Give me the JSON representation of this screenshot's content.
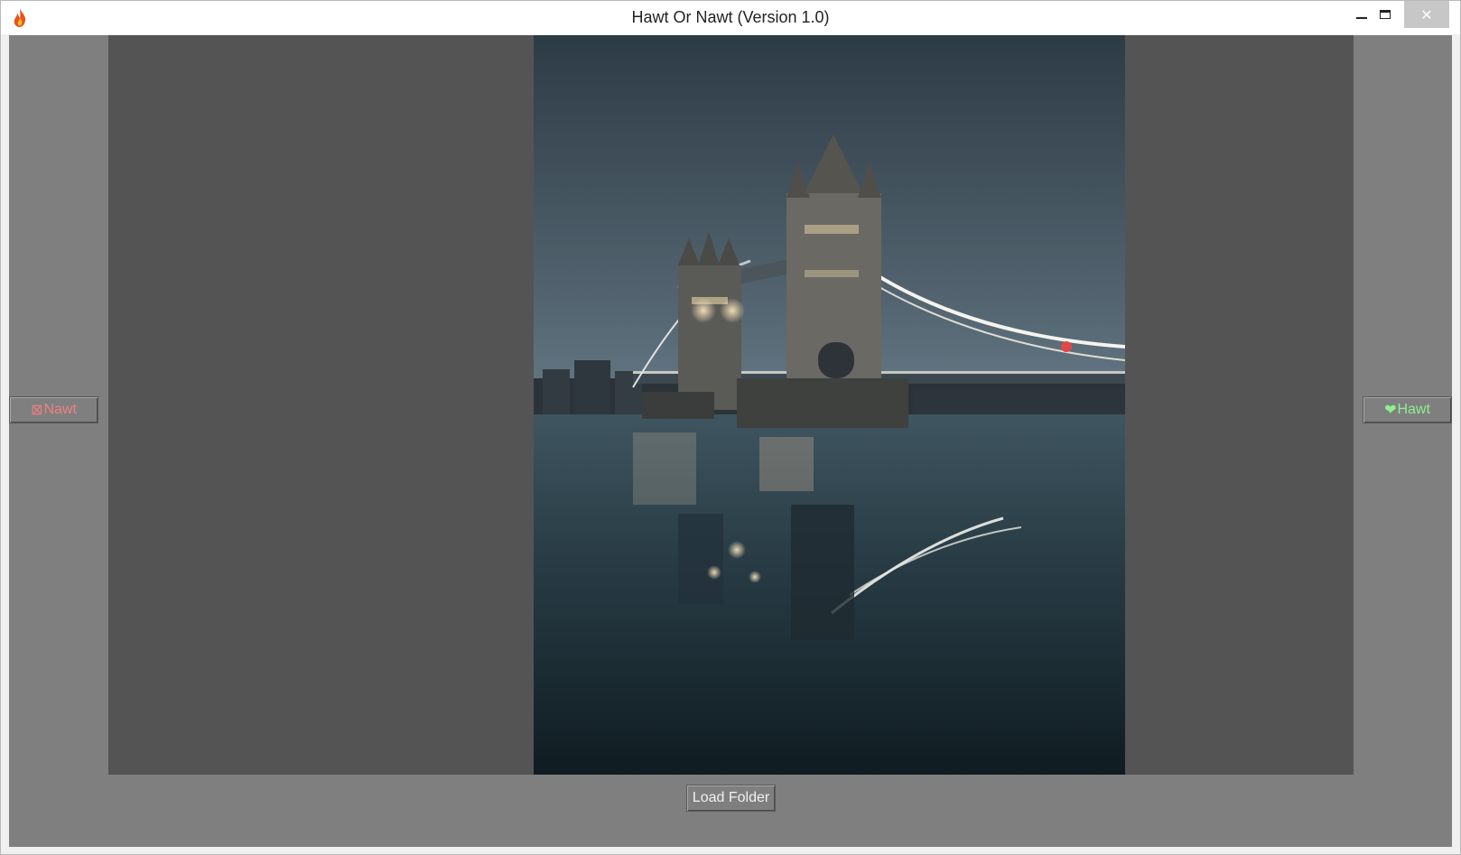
{
  "window": {
    "title": "Hawt Or Nawt (Version 1.0)",
    "icon": "flame-icon",
    "controls": {
      "minimize": "minimize-icon",
      "maximize": "maximize-icon",
      "close": "✕"
    }
  },
  "colors": {
    "client_bg": "#7f7f7f",
    "viewer_bg": "#545454",
    "nawt_text": "#f08080",
    "hawt_text": "#90ee90"
  },
  "buttons": {
    "nawt": {
      "glyph": "⊠",
      "label": "Nawt",
      "icon": "x-box-icon"
    },
    "hawt": {
      "glyph": "❤",
      "label": "Hawt",
      "icon": "heart-icon"
    },
    "load": {
      "label": "Load Folder"
    }
  },
  "image": {
    "subject": "tower-bridge-night-photo"
  }
}
